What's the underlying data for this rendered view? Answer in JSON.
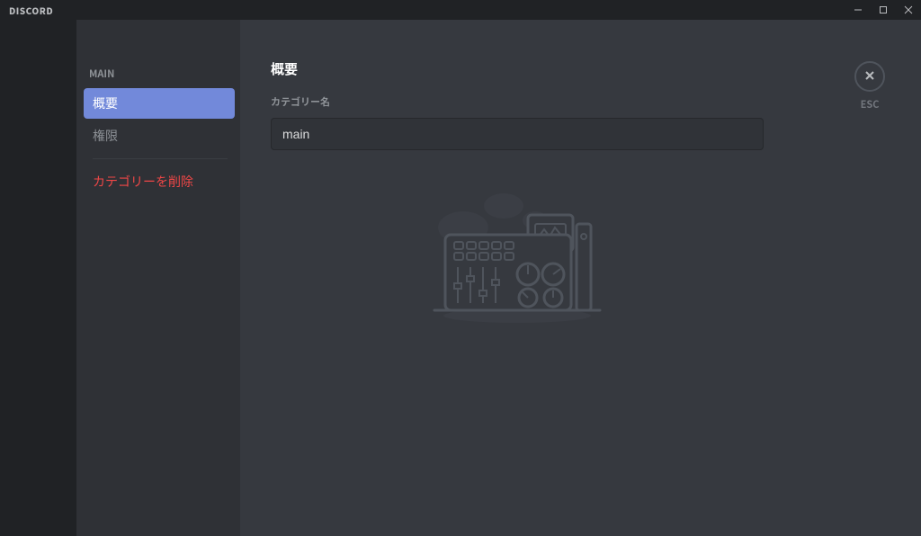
{
  "titlebar": {
    "app_name": "DISCORD"
  },
  "sidebar": {
    "header": "MAIN",
    "items": [
      {
        "label": "概要",
        "active": true
      },
      {
        "label": "権限",
        "active": false
      }
    ],
    "delete_label": "カテゴリーを削除"
  },
  "main": {
    "title": "概要",
    "category_name_label": "カテゴリー名",
    "category_name_value": "main"
  },
  "close": {
    "esc_label": "ESC"
  }
}
